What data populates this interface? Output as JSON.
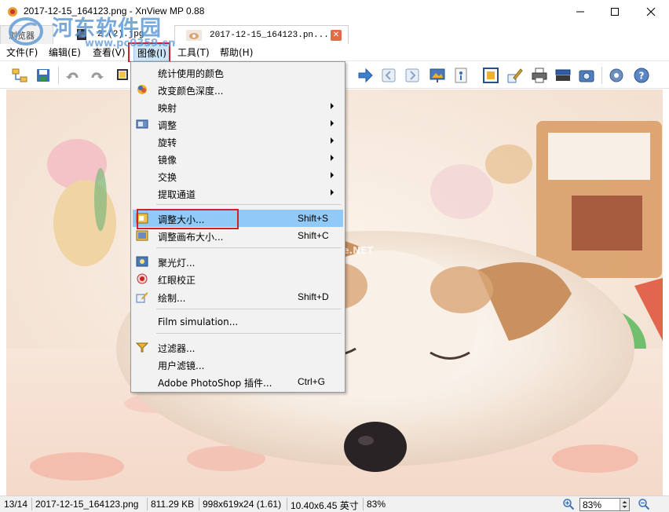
{
  "window": {
    "title": "2017-12-15_164123.png - XnView MP 0.88"
  },
  "tabs": [
    {
      "label": "浏览器",
      "active": false
    },
    {
      "label": "2 (2).jpg",
      "active": false
    },
    {
      "label": "2017-12-15_164123.pn...",
      "active": true
    }
  ],
  "watermark": {
    "name": "河东软件园",
    "url": "www.pc0359.cn",
    "site_mark": "www.pHome.NET"
  },
  "menubar": {
    "file": "文件(F)",
    "edit": "编辑(E)",
    "view": "查看(V)",
    "image": "图像(I)",
    "tools": "工具(T)",
    "help": "帮助(H)"
  },
  "toolbar": {
    "icons": [
      "browser-icon",
      "save-icon",
      "undo-icon",
      "redo-icon",
      "crop-icon",
      "next-arrow-icon",
      "first-page-icon",
      "prev-page-icon",
      "slideshow-icon",
      "info-icon",
      "fullscreen-icon",
      "edit-icon",
      "print-icon",
      "scanner-icon",
      "capture-icon",
      "settings-icon",
      "help-icon"
    ]
  },
  "image_menu": {
    "items": [
      {
        "label": "统计使用的颜色",
        "shortcut": "",
        "submenu": false,
        "icon": ""
      },
      {
        "label": "改变颜色深度...",
        "shortcut": "",
        "submenu": false,
        "icon": "color-depth-icon"
      },
      {
        "label": "映射",
        "shortcut": "",
        "submenu": true,
        "icon": ""
      },
      {
        "label": "调整",
        "shortcut": "",
        "submenu": true,
        "icon": "adjust-icon"
      },
      {
        "label": "旋转",
        "shortcut": "",
        "submenu": true,
        "icon": ""
      },
      {
        "label": "镜像",
        "shortcut": "",
        "submenu": true,
        "icon": ""
      },
      {
        "label": "交换",
        "shortcut": "",
        "submenu": true,
        "icon": ""
      },
      {
        "label": "提取通道",
        "shortcut": "",
        "submenu": true,
        "icon": ""
      },
      {
        "label": "调整大小...",
        "shortcut": "Shift+S",
        "submenu": false,
        "icon": "resize-icon"
      },
      {
        "label": "调整画布大小...",
        "shortcut": "Shift+C",
        "submenu": false,
        "icon": "canvas-resize-icon"
      },
      {
        "label": "聚光灯...",
        "shortcut": "",
        "submenu": false,
        "icon": "spotlight-icon"
      },
      {
        "label": "红眼校正",
        "shortcut": "",
        "submenu": false,
        "icon": "redeye-icon"
      },
      {
        "label": "绘制...",
        "shortcut": "Shift+D",
        "submenu": false,
        "icon": "draw-icon"
      },
      {
        "label": "Film simulation...",
        "shortcut": "",
        "submenu": false,
        "icon": ""
      },
      {
        "label": "过滤器...",
        "shortcut": "",
        "submenu": false,
        "icon": "filter-icon"
      },
      {
        "label": "用户滤镜...",
        "shortcut": "",
        "submenu": false,
        "icon": ""
      },
      {
        "label": "Adobe PhotoShop 插件...",
        "shortcut": "Ctrl+G",
        "submenu": false,
        "icon": ""
      }
    ],
    "highlighted_item": "调整大小..."
  },
  "statusbar": {
    "index": "13/14",
    "filename": "2017-12-15_164123.png",
    "filesize": "811.29 KB",
    "dimensions": "998x619x24 (1.61)",
    "print_size": "10.40x6.45 英寸",
    "zoom": "83%",
    "zoom_field": "83%"
  },
  "colors": {
    "menu_hover": "#91c9f7",
    "annotation_red": "#d0202a",
    "tab_close": "#e06c48"
  }
}
